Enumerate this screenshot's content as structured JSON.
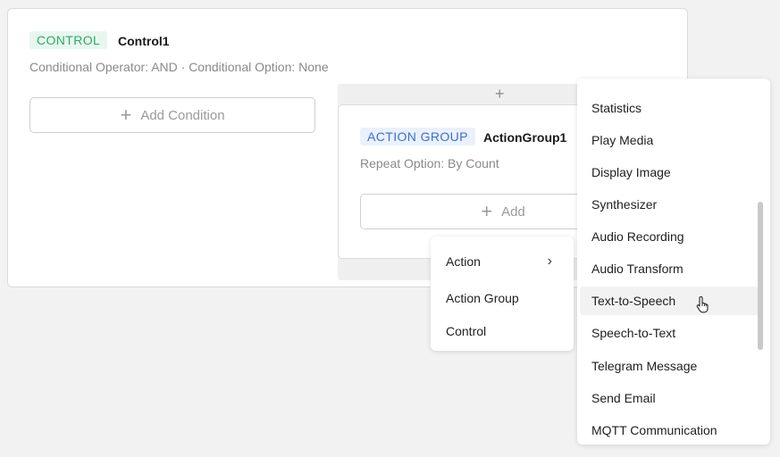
{
  "control": {
    "tag": "CONTROL",
    "name": "Control1",
    "subtitle": "Conditional Operator: AND · Conditional Option: None",
    "add_condition_label": "Add Condition"
  },
  "action_group": {
    "strip_plus": "+",
    "tag": "ACTION GROUP",
    "name": "ActionGroup1",
    "subtitle": "Repeat Option: By Count",
    "add_label": "Add"
  },
  "context_menu": {
    "items": [
      {
        "label": "Action",
        "has_submenu": true
      },
      {
        "label": "Action Group"
      },
      {
        "label": "Control"
      }
    ],
    "submenu_chevron": "›"
  },
  "submenu": {
    "items": [
      "Statistics",
      "Play Media",
      "Display Image",
      "Synthesizer",
      "Audio Recording",
      "Audio Transform",
      "Text-to-Speech",
      "Speech-to-Text",
      "Telegram Message",
      "Send Email",
      "MQTT Communication"
    ],
    "hovered_item": "Text-to-Speech"
  },
  "icons": {
    "plus": "+",
    "chevron": "chevron-right-icon",
    "cursor": "hand-pointer-icon"
  },
  "colors": {
    "control_tag_bg": "#e8f7ee",
    "control_tag_text": "#2ea86a",
    "action_group_tag_bg": "#eaf1fc",
    "action_group_tag_text": "#3a6fd0"
  }
}
